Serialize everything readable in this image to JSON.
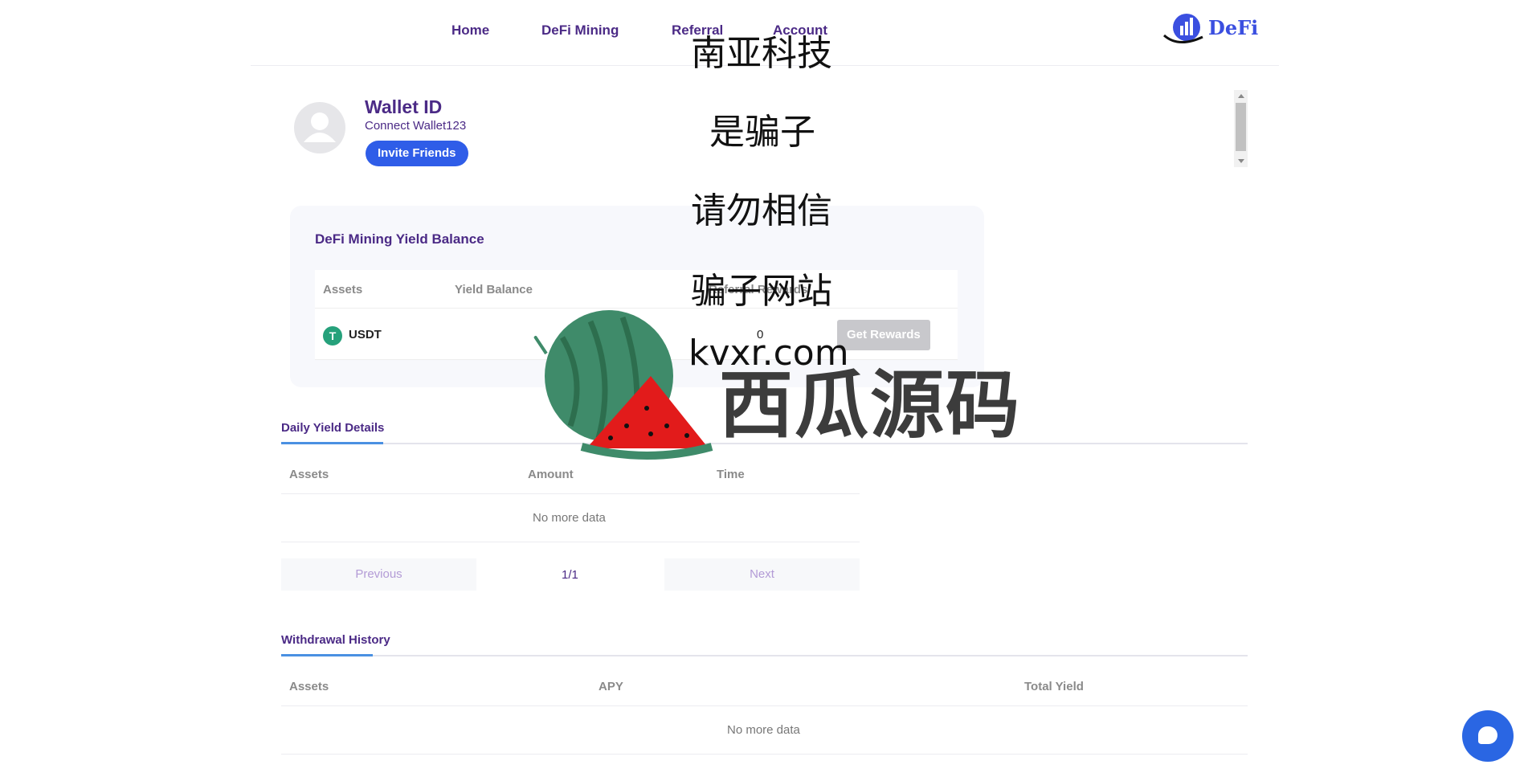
{
  "nav": {
    "items": [
      "Home",
      "DeFi Mining",
      "Referral",
      "Account"
    ],
    "logo_text": "DeFi"
  },
  "profile": {
    "title": "Wallet ID",
    "subtitle": "Connect Wallet123",
    "invite_label": "Invite Friends"
  },
  "yield_balance": {
    "title": "DeFi Mining Yield Balance",
    "headers": [
      "Assets",
      "Yield Balance",
      "Referral Rewards"
    ],
    "row": {
      "asset": "USDT",
      "referral_rewards": "0",
      "button_label": "Get Rewards"
    }
  },
  "daily_yield": {
    "tab_label": "Daily Yield Details",
    "headers": [
      "Assets",
      "Amount",
      "Time"
    ],
    "empty_text": "No more data",
    "pager": {
      "prev_label": "Previous",
      "page_indicator": "1/1",
      "next_label": "Next"
    }
  },
  "withdrawal": {
    "tab_label": "Withdrawal History",
    "headers": [
      "Assets",
      "APY",
      "Total Yield"
    ],
    "empty_text": "No more data"
  },
  "watermark": {
    "lines": [
      "南亚科技",
      "是骗子",
      "请勿相信",
      "骗子网站",
      "kvxr.com"
    ],
    "brand": "西瓜源码"
  },
  "colors": {
    "brand_purple": "#4b2a86",
    "invite_blue": "#2f5de8",
    "chat_blue": "#2a66e3",
    "usdt_green": "#26a17b",
    "tab_underline": "#4a90e2"
  },
  "icons": [
    "defi-logo-icon",
    "avatar-placeholder-icon",
    "usdt-icon",
    "chat-icon",
    "scroll-arrow-icon"
  ]
}
